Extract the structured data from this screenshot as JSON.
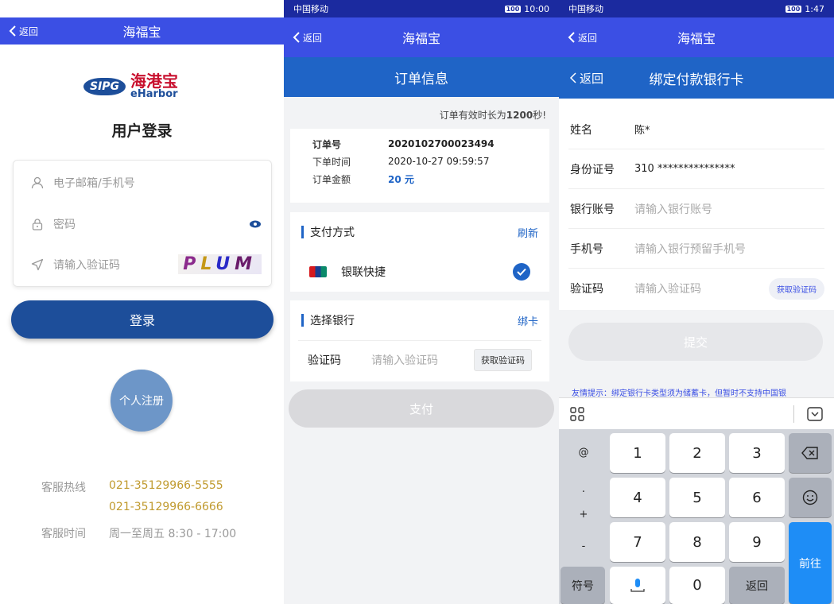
{
  "panel1": {
    "nav": {
      "back": "返回",
      "title": "海福宝"
    },
    "logo": {
      "sipg": "SIPG",
      "cn": "海港宝",
      "en": "eHarbor"
    },
    "title": "用户登录",
    "fields": {
      "account_placeholder": "电子邮箱/手机号",
      "password_placeholder": "密码",
      "captcha_placeholder": "请输入验证码",
      "captcha": [
        "P",
        "L",
        "U",
        "M"
      ]
    },
    "login": "登录",
    "register": "个人注册",
    "service": {
      "hotline_label": "客服热线",
      "phone1": "021-35129966-5555",
      "phone2": "021-35129966-6666",
      "time_label": "客服时间",
      "time": "周一至周五 8:30 - 17:00"
    }
  },
  "panel2": {
    "status": {
      "carrier": "中国移动",
      "time": "10:00",
      "battery": "100"
    },
    "nav": {
      "back": "返回",
      "title": "海福宝"
    },
    "header": "订单信息",
    "tip_prefix": "订单有效时长为",
    "tip_seconds": "1200",
    "tip_suffix": "秒!",
    "order": {
      "no_label": "订单号",
      "no": "2020102700023494",
      "time_label": "下单时间",
      "time": "2020-10-27 09:59:57",
      "amount_label": "订单金额",
      "amount": "20 元"
    },
    "pay_method": {
      "title": "支付方式",
      "refresh": "刷新",
      "option": "银联快捷"
    },
    "bank": {
      "title": "选择银行",
      "bind": "绑卡",
      "code_label": "验证码",
      "code_placeholder": "请输入验证码",
      "get_code": "获取验证码"
    },
    "pay": "支付"
  },
  "panel3": {
    "status": {
      "carrier": "中国移动",
      "time": "1:47",
      "battery": "100"
    },
    "nav": {
      "back": "返回",
      "title": "海福宝"
    },
    "header": {
      "back": "返回",
      "title": "绑定付款银行卡"
    },
    "fields": [
      {
        "label": "姓名",
        "value": "陈*"
      },
      {
        "label": "身份证号",
        "value": "310 ***************"
      },
      {
        "label": "银行账号",
        "placeholder": "请输入银行账号"
      },
      {
        "label": "手机号",
        "placeholder": "请输入银行预留手机号"
      },
      {
        "label": "验证码",
        "placeholder": "请输入验证码",
        "action": "获取验证码"
      }
    ],
    "submit": "提交",
    "tip": "友情提示：绑定银行卡类型须为储蓄卡，但暂时不支持中国银",
    "keyboard": {
      "side": [
        "@",
        ".",
        "+",
        "-"
      ],
      "digits": [
        "1",
        "2",
        "3",
        "4",
        "5",
        "6",
        "7",
        "8",
        "9",
        "0"
      ],
      "symbol": "符号",
      "back": "返回",
      "go": "前往"
    }
  },
  "colors": {
    "nav": "#3b4fe4",
    "primary": "#1d4e9a",
    "gold": "#c09a2e",
    "blue_head": "#1f64c6"
  }
}
